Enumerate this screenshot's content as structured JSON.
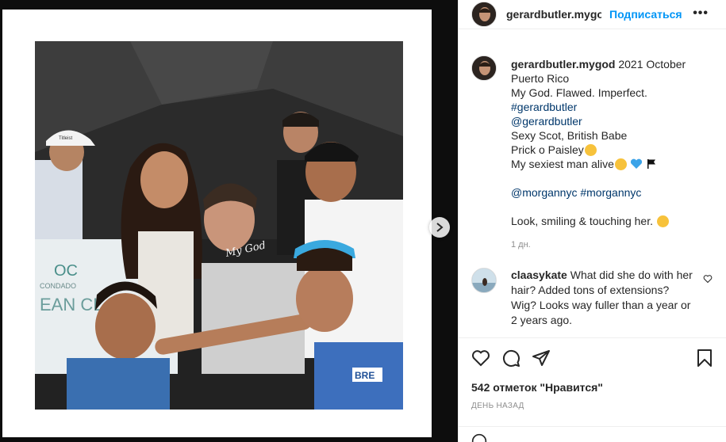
{
  "post": {
    "username": "gerardbutler.mygoc",
    "follow_label": "Подписаться",
    "more_label": "•••"
  },
  "photo": {
    "signature": "My God",
    "banner_top": "CONDADO",
    "banner_bottom": "EAN CL",
    "banner_mark": "OC",
    "jersey_text": "BRE",
    "cap_logo": "Titleist"
  },
  "caption": {
    "username": "gerardbutler.mygod",
    "first_line": "2021 October",
    "lines": [
      "Puerto Rico",
      "My God. Flawed. Imperfect."
    ],
    "hashtag_1": "#gerardbutler",
    "mention_1": "@gerardbutler",
    "line_sexy": "Sexy Scot, British Babe",
    "line_prick": "Prick o Paisley",
    "line_sexiest": "My sexiest man alive",
    "mention_2": "@morgannyc",
    "hashtag_2": "#morgannyc",
    "line_look": "Look, smiling & touching her.",
    "time": "1 дн."
  },
  "comment": {
    "username": "claasykate",
    "text": "What did she do with her hair? Added tons of extensions? Wig? Looks way fuller than a year or 2 years ago."
  },
  "actions": {
    "likes": "542 отметок \"Нравится\"",
    "ago": "День назад"
  },
  "colors": {
    "link": "#0095f6",
    "hashtag": "#00376b",
    "text": "#262626",
    "muted": "#8e8e8e"
  }
}
